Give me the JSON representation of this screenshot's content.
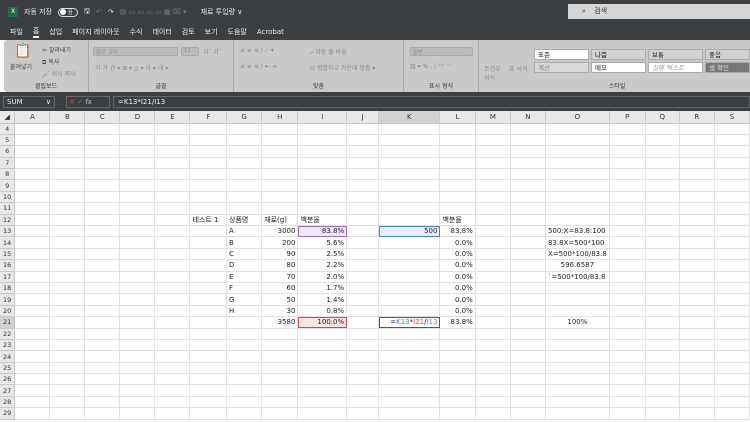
{
  "titlebar": {
    "autosave": "자동 저장",
    "toggle": "끔",
    "doc_title": "재료 투입량 ∨",
    "search_placeholder": "검색"
  },
  "menu": [
    "파일",
    "홈",
    "삽입",
    "페이지 레이아웃",
    "수식",
    "데이터",
    "검토",
    "보기",
    "도움말",
    "Acrobat"
  ],
  "ribbon": {
    "clipboard": {
      "paste": "붙여넣기",
      "cut": "잘라내기",
      "copy": "복사",
      "format_painter": "서식 복사",
      "label": "클립보드"
    },
    "font": {
      "font_name": "맑은 고딕",
      "font_size": "11",
      "label": "글꼴"
    },
    "alignment": {
      "wrap": "자동 줄 바꿈",
      "merge": "병합하고 가운데 맞춤",
      "label": "맞춤"
    },
    "number": {
      "format": "일반",
      "label": "표시 형식"
    },
    "conditional": "조건부 서식",
    "table_format": "표 서식",
    "styles": {
      "items": [
        "표준",
        "나쁨",
        "보통",
        "좋음",
        "계산",
        "메모",
        "설명 텍스트",
        "셀 확인"
      ],
      "label": "스타일"
    }
  },
  "formula_bar": {
    "name_box": "SUM",
    "formula": "=K13*I21/I13"
  },
  "columns": [
    "A",
    "B",
    "C",
    "D",
    "E",
    "F",
    "G",
    "H",
    "I",
    "J",
    "K",
    "L",
    "M",
    "N",
    "O",
    "P",
    "Q",
    "R",
    "S"
  ],
  "rows": [
    4,
    5,
    6,
    7,
    8,
    9,
    10,
    11,
    12,
    13,
    14,
    15,
    16,
    17,
    18,
    19,
    20,
    21,
    22,
    23,
    24,
    25,
    26,
    27,
    28,
    29
  ],
  "cells": {
    "F12": "테스트 1",
    "G12": "상품명",
    "H12": "재료(g)",
    "I12": "백분율",
    "L12": "백분율",
    "G13": "A",
    "H13": "3000",
    "I13": "83.8%",
    "K13": "500",
    "L13": "83.8%",
    "O13": "500:X=83.8:100",
    "G14": "B",
    "H14": "200",
    "I14": "5.6%",
    "L14": "0.0%",
    "O14": "83.8X=500*100",
    "G15": "C",
    "H15": "90",
    "I15": "2.5%",
    "L15": "0.0%",
    "O15": "X=500*100/83.8",
    "G16": "D",
    "H16": "80",
    "I16": "2.2%",
    "L16": "0.0%",
    "O16": "596.6587",
    "G17": "E",
    "H17": "70",
    "I17": "2.0%",
    "L17": "0.0%",
    "O17": "`=500*100/83.8",
    "G18": "F",
    "H18": "60",
    "I18": "1.7%",
    "L18": "0.0%",
    "G19": "G",
    "H19": "50",
    "I19": "1.4%",
    "L19": "0.0%",
    "G20": "H",
    "H20": "30",
    "I20": "0.8%",
    "L20": "0.0%",
    "H21": "3580",
    "I21": "100.0%",
    "L21": "83.8%",
    "O21": "100%"
  },
  "editing": {
    "cell": "K21",
    "parts": [
      {
        "t": "=",
        "c": "#222"
      },
      {
        "t": "K13",
        "c": "#4a7fd4"
      },
      {
        "t": "*",
        "c": "#222"
      },
      {
        "t": "I21",
        "c": "#d04a4a"
      },
      {
        "t": "/",
        "c": "#222"
      },
      {
        "t": "I13",
        "c": "#9a6bc7"
      }
    ]
  },
  "colors": {
    "excel_green": "#217346",
    "ref_blue": "#4a7fd4",
    "ref_red": "#d04a4a",
    "ref_purple": "#9a6bc7"
  }
}
